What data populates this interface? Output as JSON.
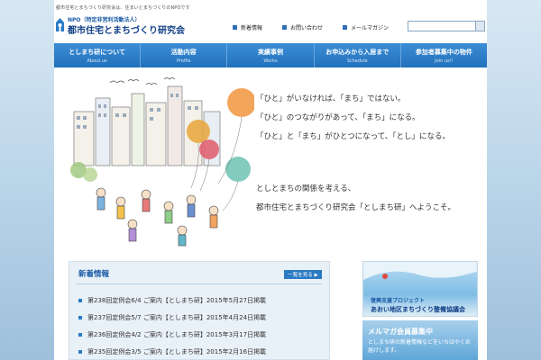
{
  "header": {
    "tagline": "都市住宅とまちづくり研究会は、住まいとまちづくりのNPOです",
    "logo_sub": "NPO（特定非営利活動法人）",
    "logo_main": "都市住宅とまちづくり研究会",
    "links": [
      {
        "label": "新着情報"
      },
      {
        "label": "お問い合わせ"
      },
      {
        "label": "メールマガジン"
      }
    ],
    "search_placeholder": "",
    "search_value": ""
  },
  "nav": [
    {
      "label": "としまち研について",
      "sub": "About us"
    },
    {
      "label": "活動内容",
      "sub": "Profile"
    },
    {
      "label": "実績事例",
      "sub": "Works"
    },
    {
      "label": "お申込みから入居まで",
      "sub": "Schedule"
    },
    {
      "label": "参加者募集中の物件",
      "sub": "Join us!!"
    }
  ],
  "hero": {
    "lines": [
      "「ひと」がいなければ、「まち」ではない。",
      "「ひと」のつながりがあって、「まち」になる。",
      "「ひと」と「まち」がひとつになって、「とし」になる。"
    ],
    "welcome": [
      "としとまちの関係を考える、",
      "都市住宅とまちづくり研究会「としまち研」へようこそ。"
    ]
  },
  "news": {
    "title": "新着情報",
    "more_label": "一覧を見る ▶",
    "items": [
      {
        "text": "第238回定例会6/4 ご案内【としまち研】2015年5月27日掲載"
      },
      {
        "text": "第237回定例会5/7 ご案内【としまち研】2015年4月24日掲載"
      },
      {
        "text": "第236回定例会4/2 ご案内【としまち研】2015年3月17日掲載"
      },
      {
        "text": "第235回定例会3/5 ご案内【としまち研】2015年2月16日掲載"
      }
    ]
  },
  "sidebar": {
    "banner1_sub": "復興支援プロジェクト",
    "banner1_main": "あおい地区まちづくり整備協議会",
    "banner2_title": "メルマガ会員募集中",
    "banner2_text": "としまち研の新着情報などをいちはやくお届けします。"
  },
  "colors": {
    "brand": "#2a7ac4",
    "brand_dark": "#0f3e86",
    "news_bg": "#e9f1f8"
  }
}
